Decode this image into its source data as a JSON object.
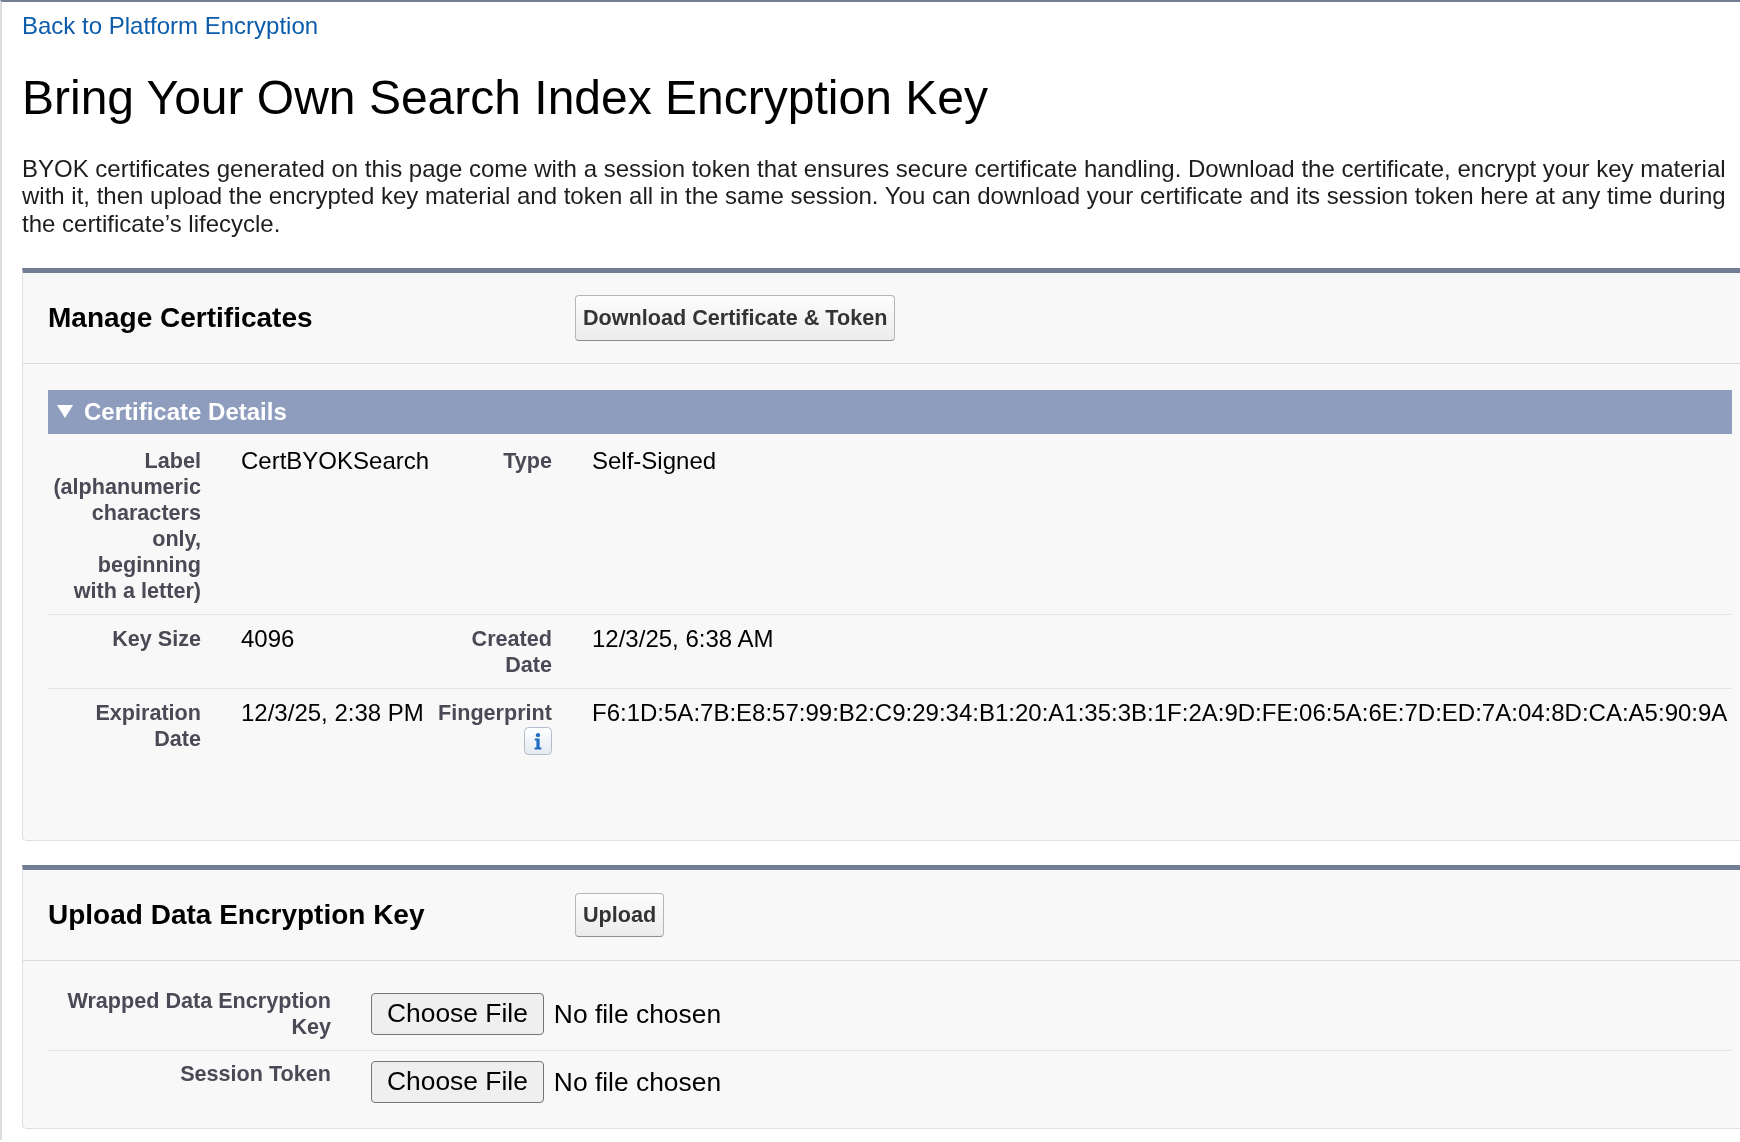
{
  "back_link": "Back to Platform Encryption",
  "page_title": "Bring Your Own Search Index Encryption Key",
  "description": "BYOK certificates generated on this page come with a session token that ensures secure certificate handling. Download the certificate, encrypt your key material with it, then upload the encrypted key material and token all in the same session. You can download your certificate and its session token here at any time during the certificate’s lifecycle.",
  "manage_certificates": {
    "title": "Manage Certificates",
    "button": "Download Certificate & Token",
    "certificate_details": {
      "title": "Certificate Details",
      "expanded": true,
      "rows": [
        {
          "cells": [
            {
              "label": "Label (alphanumeric characters only, beginning with a letter)",
              "value": "CertBYOKSearch",
              "info_icon": false
            },
            {
              "label": "Type",
              "value": "Self-Signed",
              "info_icon": false
            }
          ]
        },
        {
          "cells": [
            {
              "label": "Key Size",
              "value": "4096",
              "info_icon": false
            },
            {
              "label": "Created Date",
              "value": "12/3/25, 6:38 AM",
              "info_icon": false
            }
          ]
        },
        {
          "cells": [
            {
              "label": "Expiration Date",
              "value": "12/3/25, 2:38 PM",
              "info_icon": false
            },
            {
              "label": "Fingerprint",
              "value": "F6:1D:5A:7B:E8:57:99:B2:C9:29:34:B1:20:A1:35:3B:1F:2A:9D:FE:06:5A:6E:7D:ED:7A:04:8D:CA:A5:90:9A",
              "info_icon": true
            }
          ]
        }
      ]
    }
  },
  "upload_key": {
    "title": "Upload Data Encryption Key",
    "button": "Upload",
    "fields": [
      {
        "label": "Wrapped Data Encryption Key",
        "button": "Choose File",
        "status": "No file chosen"
      },
      {
        "label": "Session Token",
        "button": "Choose File",
        "status": "No file chosen"
      }
    ]
  }
}
